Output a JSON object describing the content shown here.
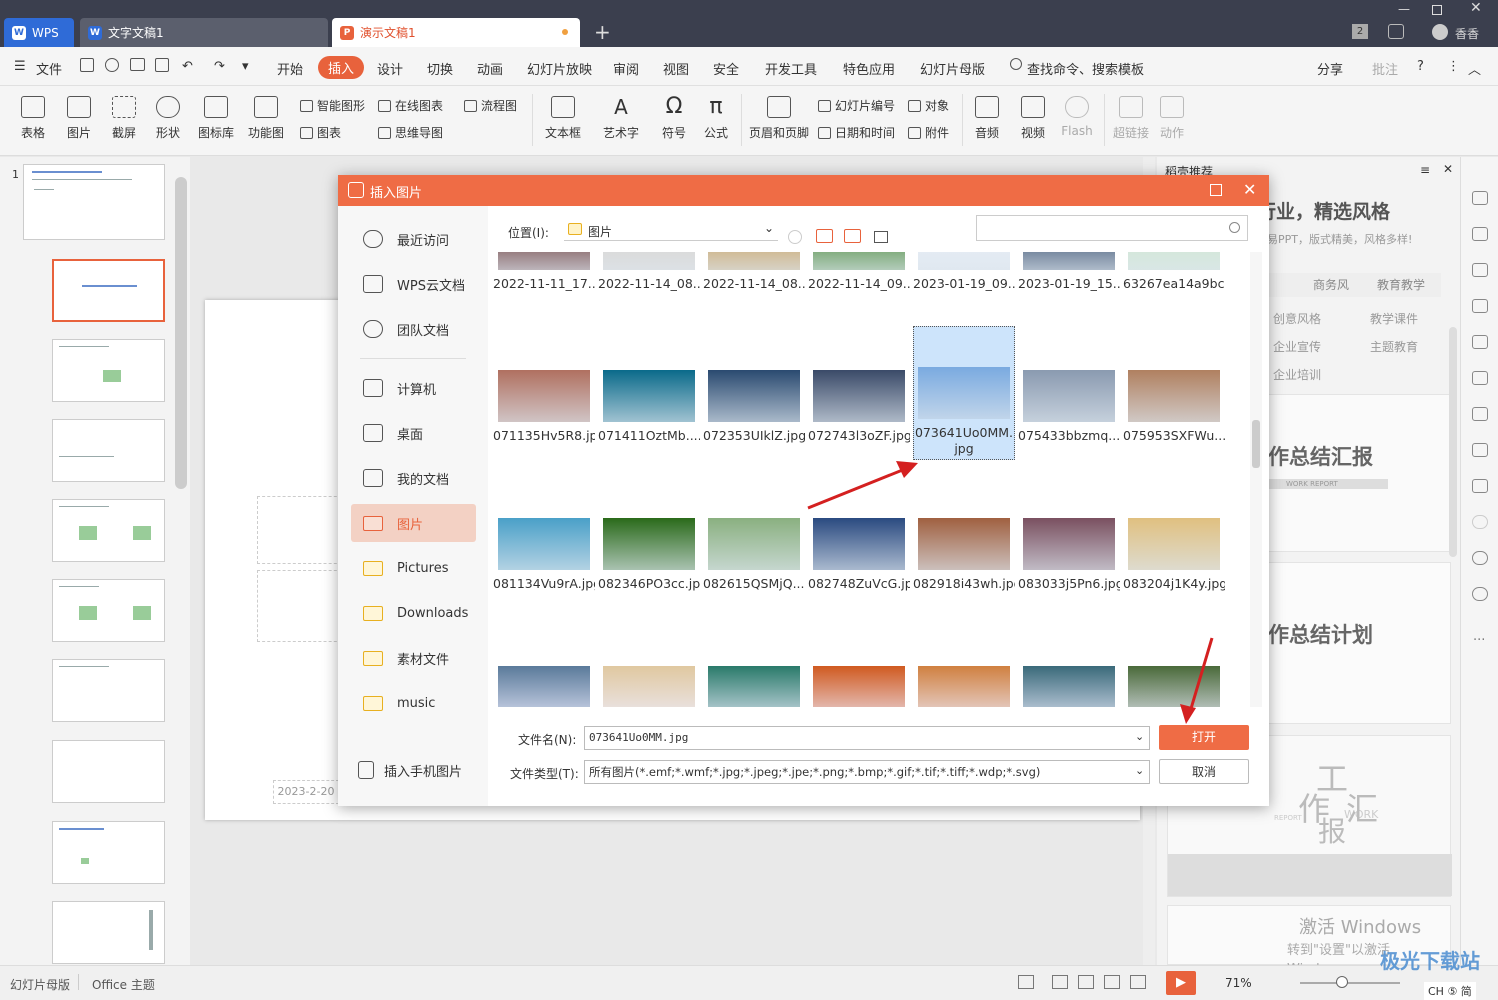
{
  "titlebar": {
    "wps_label": "WPS",
    "doc_tab": "文字文稿1",
    "ppt_tab": "演示文稿1",
    "new_tab": "+",
    "user": "香香",
    "page_badge": "2"
  },
  "menu": {
    "file": "文件",
    "items": [
      "开始",
      "插入",
      "设计",
      "切换",
      "动画",
      "幻灯片放映",
      "审阅",
      "视图",
      "安全",
      "开发工具",
      "特色应用",
      "幻灯片母版"
    ],
    "search": "查找命令、搜索模板",
    "share": "分享",
    "comment": "批注"
  },
  "ribbon": {
    "big": [
      "表格",
      "图片",
      "截屏",
      "形状",
      "图标库",
      "功能图",
      "文本框",
      "艺术字",
      "符号",
      "公式",
      "页眉和页脚",
      "音频",
      "视频",
      "Flash",
      "超链接",
      "动作"
    ],
    "small": [
      "智能图形",
      "在线图表",
      "流程图",
      "图表",
      "思维导图",
      "幻灯片编号",
      "对象",
      "日期和时间",
      "附件"
    ]
  },
  "slides": {
    "count_label": "1",
    "date_placeholder": "2023-2-20"
  },
  "right_panel": {
    "header": "稻壳推荐",
    "headline": "行业，精选风格",
    "sub": "易PPT，版式精美，风格多样!",
    "tags": [
      "商务风",
      "教育教学",
      "创意风格",
      "教学课件",
      "企业宣传",
      "主题教育",
      "企业培训"
    ],
    "card1": "作总结汇报",
    "card1_sub": "WORK REPORT",
    "card2": "作总结计划",
    "card3a": "工",
    "card3b": "作",
    "card3c": "汇",
    "card3d": "报",
    "card3_en": "WORK",
    "card3_rep": "REPORT",
    "watermark": "激活 Windows",
    "watermark_sub": "转到\"设置\"以激活 Windows。"
  },
  "status": {
    "master": "幻灯片母版",
    "theme": "Office 主题",
    "zoom": "71%",
    "ime": "CH ⑤ 简"
  },
  "dialog": {
    "title": "插入图片",
    "location_label": "位置(I):",
    "location_value": "图片",
    "side": [
      "最近访问",
      "WPS云文档",
      "团队文档",
      "计算机",
      "桌面",
      "我的文档",
      "图片",
      "Pictures",
      "Downloads",
      "素材文件",
      "music"
    ],
    "phone": "插入手机图片",
    "row0": [
      "2022-11-11_17...",
      "2022-11-14_08...",
      "2022-11-14_08...",
      "2022-11-14_09...",
      "2023-01-19_09...",
      "2023-01-19_15...",
      "63267ea14a9bc..."
    ],
    "row1": [
      "071135Hv5R8.jpg",
      "071411OztMb....",
      "072353UIklZ.jpg",
      "072743l3oZF.jpg",
      "073641Uo0MM.jpg",
      "075433bbzmq....",
      "075953SXFWu...."
    ],
    "row2": [
      "081134Vu9rA.jpg",
      "082346PO3cc.jpg",
      "082615QSMjQ....",
      "082748ZuVcG.jpg",
      "082918i43wh.jpg",
      "083033j5Pn6.jpg",
      "083204j1K4y.jpg"
    ],
    "filename_label": "文件名(N):",
    "filename_value": "073641Uo0MM.jpg",
    "filetype_label": "文件类型(T):",
    "filetype_value": "所有图片(*.emf;*.wmf;*.jpg;*.jpeg;*.jpe;*.png;*.bmp;*.gif;*.tif;*.tiff;*.wdp;*.svg)",
    "open": "打开",
    "cancel": "取消"
  },
  "site_watermark": "极光下载站"
}
